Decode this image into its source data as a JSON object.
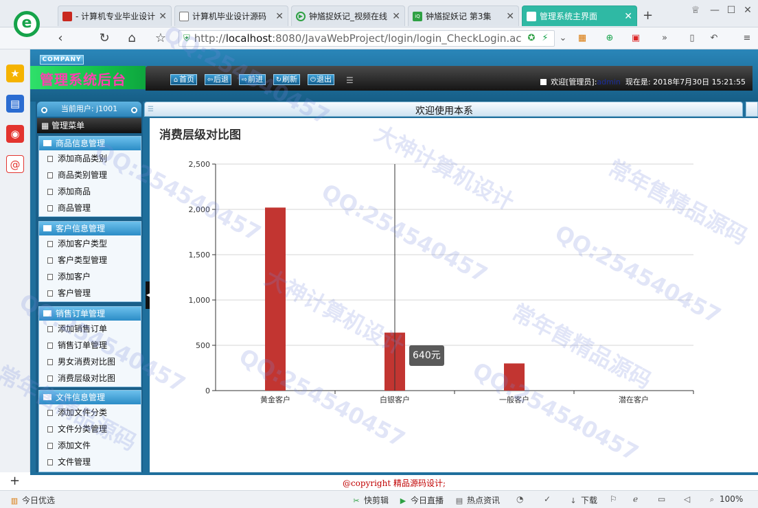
{
  "browser": {
    "tabs": [
      {
        "title": "- 计算机专业毕业设计",
        "icon": "red-flag-icon"
      },
      {
        "title": "计算机毕业设计源码",
        "icon": "document-icon"
      },
      {
        "title": "钟馗捉妖记_视频在线",
        "icon": "play-icon"
      },
      {
        "title": "钟馗捉妖记 第3集",
        "icon": "iqiyi-icon"
      },
      {
        "title": "管理系统主界面",
        "icon": "document-icon",
        "active": true
      }
    ],
    "url_prefix": "http://",
    "url_host": "localhost",
    "url_rest": ":8080/JavaWebProject/login/login_CheckLogin.ac",
    "colors": {
      "active_tab": "#2fb9a4",
      "logo": "#16a34a"
    }
  },
  "header": {
    "company": "COMPANY",
    "app_title": "管理系统后台",
    "buttons": [
      {
        "label": "首页",
        "icon": "home-icon",
        "glyph": "⌂"
      },
      {
        "label": "后退",
        "icon": "back-arrow-icon",
        "glyph": "⇦"
      },
      {
        "label": "前进",
        "icon": "forward-arrow-icon",
        "glyph": "⇨"
      },
      {
        "label": "刷新",
        "icon": "refresh-icon",
        "glyph": "↻"
      },
      {
        "label": "退出",
        "icon": "power-icon",
        "glyph": "⏻"
      }
    ],
    "welcome_prefix": "欢迎[管理员]:",
    "welcome_user": "admin",
    "now_label": "现在是:",
    "datetime": "2018年7月30日 15:21:55"
  },
  "sidebar": {
    "current_user": "当前用户: j1001",
    "menu_title": "管理菜单",
    "groups": [
      {
        "title": "商品信息管理",
        "items": [
          "添加商品类别",
          "商品类别管理",
          "添加商品",
          "商品管理"
        ]
      },
      {
        "title": "客户信息管理",
        "items": [
          "添加客户类型",
          "客户类型管理",
          "添加客户",
          "客户管理"
        ]
      },
      {
        "title": "销售订单管理",
        "items": [
          "添加销售订单",
          "销售订单管理",
          "男女消费对比图",
          "消费层级对比图"
        ]
      },
      {
        "title": "文件信息管理",
        "items": [
          "添加文件分类",
          "文件分类管理",
          "添加文件",
          "文件管理"
        ]
      }
    ]
  },
  "content": {
    "heading": "欢迎使用本系",
    "tooltip": "640元"
  },
  "chart_data": {
    "type": "bar",
    "title": "消费层级对比图",
    "categories": [
      "黄金客户",
      "白银客户",
      "一般客户",
      "潜在客户"
    ],
    "values": [
      2020,
      640,
      300,
      0
    ],
    "ylim": [
      0,
      2500
    ],
    "yticks": [
      0,
      500,
      1000,
      1500,
      2000,
      2500
    ],
    "ytick_labels": [
      "0",
      "500",
      "1,000",
      "1,500",
      "2,000",
      "2,500"
    ],
    "grid": true,
    "bar_color": "#c23531"
  },
  "footer": {
    "copyright": "@copyright 精品源码设计;"
  },
  "statusbar": {
    "left": "今日优选",
    "items": [
      "快剪辑",
      "今日直播",
      "热点资讯",
      "下载"
    ],
    "zoom": "100%"
  },
  "watermarks": [
    "QQ:254540457",
    "大神计算机设计",
    "常年售精品源码"
  ]
}
